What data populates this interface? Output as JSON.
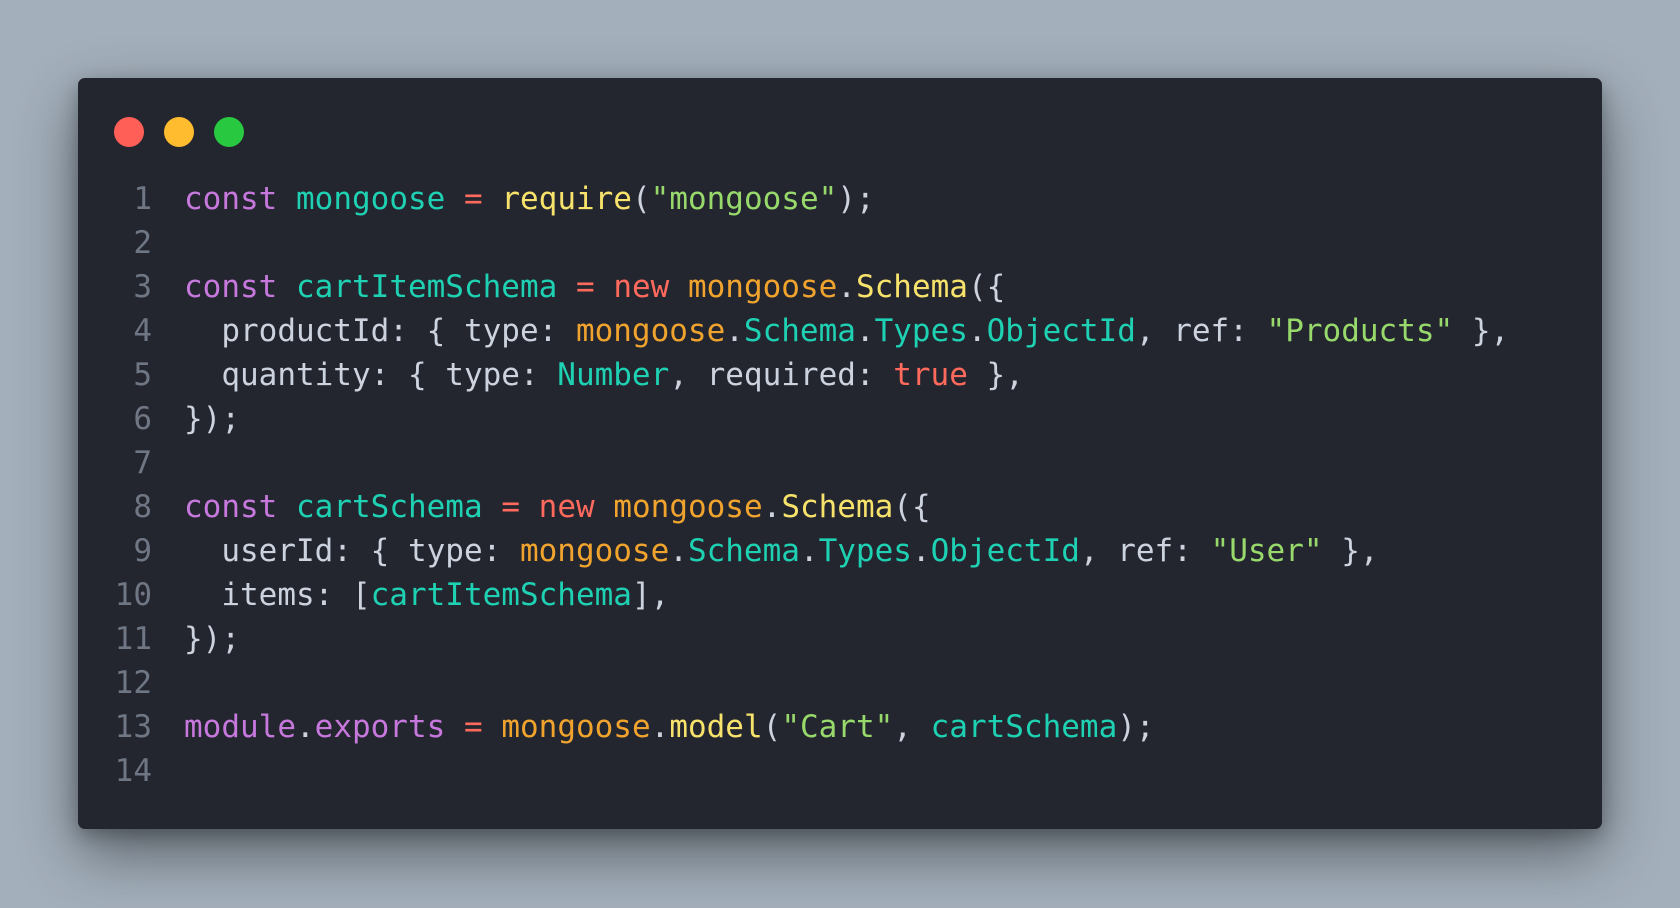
{
  "window": {
    "controls": [
      {
        "name": "close-dot",
        "color": "#ff5f57"
      },
      {
        "name": "minimize-dot",
        "color": "#febc2e"
      },
      {
        "name": "zoom-dot",
        "color": "#28c840"
      }
    ]
  },
  "colors": {
    "keyword": "#c678dd",
    "variable": "#1fd1b3",
    "operator": "#ff6a5c",
    "function": "#f7e36b",
    "object": "#f0a42e",
    "string": "#98d96b",
    "plain": "#cdd3de",
    "line_number": "#6f7684"
  },
  "code": {
    "lines": [
      {
        "number": "1",
        "tokens": [
          {
            "text": "const",
            "kind": "keyword"
          },
          {
            "text": " ",
            "kind": "plain"
          },
          {
            "text": "mongoose",
            "kind": "variable"
          },
          {
            "text": " ",
            "kind": "plain"
          },
          {
            "text": "=",
            "kind": "operator"
          },
          {
            "text": " ",
            "kind": "plain"
          },
          {
            "text": "require",
            "kind": "function"
          },
          {
            "text": "(",
            "kind": "plain"
          },
          {
            "text": "\"mongoose\"",
            "kind": "string"
          },
          {
            "text": ");",
            "kind": "plain"
          }
        ]
      },
      {
        "number": "2",
        "tokens": []
      },
      {
        "number": "3",
        "tokens": [
          {
            "text": "const",
            "kind": "keyword"
          },
          {
            "text": " ",
            "kind": "plain"
          },
          {
            "text": "cartItemSchema",
            "kind": "variable"
          },
          {
            "text": " ",
            "kind": "plain"
          },
          {
            "text": "=",
            "kind": "operator"
          },
          {
            "text": " ",
            "kind": "plain"
          },
          {
            "text": "new",
            "kind": "operator"
          },
          {
            "text": " ",
            "kind": "plain"
          },
          {
            "text": "mongoose",
            "kind": "object"
          },
          {
            "text": ".",
            "kind": "plain"
          },
          {
            "text": "Schema",
            "kind": "function"
          },
          {
            "text": "({",
            "kind": "plain"
          }
        ]
      },
      {
        "number": "4",
        "tokens": [
          {
            "text": "  productId: { type: ",
            "kind": "plain"
          },
          {
            "text": "mongoose",
            "kind": "object"
          },
          {
            "text": ".",
            "kind": "plain"
          },
          {
            "text": "Schema",
            "kind": "variable"
          },
          {
            "text": ".",
            "kind": "plain"
          },
          {
            "text": "Types",
            "kind": "variable"
          },
          {
            "text": ".",
            "kind": "plain"
          },
          {
            "text": "ObjectId",
            "kind": "variable"
          },
          {
            "text": ", ref: ",
            "kind": "plain"
          },
          {
            "text": "\"Products\"",
            "kind": "string"
          },
          {
            "text": " },",
            "kind": "plain"
          }
        ]
      },
      {
        "number": "5",
        "tokens": [
          {
            "text": "  quantity: { type: ",
            "kind": "plain"
          },
          {
            "text": "Number",
            "kind": "variable"
          },
          {
            "text": ", required: ",
            "kind": "plain"
          },
          {
            "text": "true",
            "kind": "operator"
          },
          {
            "text": " },",
            "kind": "plain"
          }
        ]
      },
      {
        "number": "6",
        "tokens": [
          {
            "text": "});",
            "kind": "plain"
          }
        ]
      },
      {
        "number": "7",
        "tokens": []
      },
      {
        "number": "8",
        "tokens": [
          {
            "text": "const",
            "kind": "keyword"
          },
          {
            "text": " ",
            "kind": "plain"
          },
          {
            "text": "cartSchema",
            "kind": "variable"
          },
          {
            "text": " ",
            "kind": "plain"
          },
          {
            "text": "=",
            "kind": "operator"
          },
          {
            "text": " ",
            "kind": "plain"
          },
          {
            "text": "new",
            "kind": "operator"
          },
          {
            "text": " ",
            "kind": "plain"
          },
          {
            "text": "mongoose",
            "kind": "object"
          },
          {
            "text": ".",
            "kind": "plain"
          },
          {
            "text": "Schema",
            "kind": "function"
          },
          {
            "text": "({",
            "kind": "plain"
          }
        ]
      },
      {
        "number": "9",
        "tokens": [
          {
            "text": "  userId: { type: ",
            "kind": "plain"
          },
          {
            "text": "mongoose",
            "kind": "object"
          },
          {
            "text": ".",
            "kind": "plain"
          },
          {
            "text": "Schema",
            "kind": "variable"
          },
          {
            "text": ".",
            "kind": "plain"
          },
          {
            "text": "Types",
            "kind": "variable"
          },
          {
            "text": ".",
            "kind": "plain"
          },
          {
            "text": "ObjectId",
            "kind": "variable"
          },
          {
            "text": ", ref: ",
            "kind": "plain"
          },
          {
            "text": "\"User\"",
            "kind": "string"
          },
          {
            "text": " },",
            "kind": "plain"
          }
        ]
      },
      {
        "number": "10",
        "tokens": [
          {
            "text": "  items: [",
            "kind": "plain"
          },
          {
            "text": "cartItemSchema",
            "kind": "variable"
          },
          {
            "text": "],",
            "kind": "plain"
          }
        ]
      },
      {
        "number": "11",
        "tokens": [
          {
            "text": "});",
            "kind": "plain"
          }
        ]
      },
      {
        "number": "12",
        "tokens": []
      },
      {
        "number": "13",
        "tokens": [
          {
            "text": "module",
            "kind": "keyword"
          },
          {
            "text": ".",
            "kind": "plain"
          },
          {
            "text": "exports",
            "kind": "keyword"
          },
          {
            "text": " ",
            "kind": "plain"
          },
          {
            "text": "=",
            "kind": "operator"
          },
          {
            "text": " ",
            "kind": "plain"
          },
          {
            "text": "mongoose",
            "kind": "object"
          },
          {
            "text": ".",
            "kind": "plain"
          },
          {
            "text": "model",
            "kind": "function"
          },
          {
            "text": "(",
            "kind": "plain"
          },
          {
            "text": "\"Cart\"",
            "kind": "string"
          },
          {
            "text": ", ",
            "kind": "plain"
          },
          {
            "text": "cartSchema",
            "kind": "variable"
          },
          {
            "text": ");",
            "kind": "plain"
          }
        ]
      },
      {
        "number": "14",
        "tokens": []
      }
    ]
  }
}
